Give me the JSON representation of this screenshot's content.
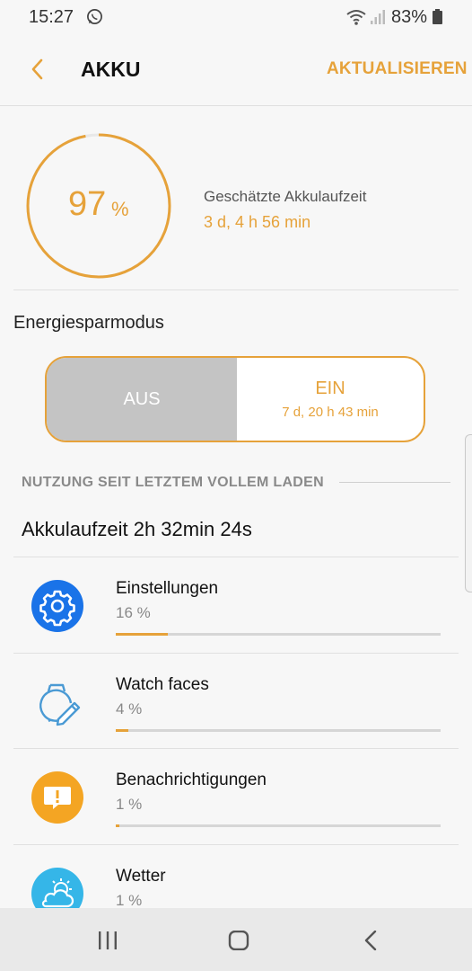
{
  "status_bar": {
    "time": "15:27",
    "battery_percent": "83%",
    "icons": [
      "whatsapp-icon",
      "wifi-icon",
      "signal-icon",
      "battery-icon"
    ]
  },
  "header": {
    "title": "AKKU",
    "action": "AKTUALISIEREN"
  },
  "battery": {
    "percent": "97",
    "percent_unit": "%",
    "level": 0.97,
    "estimate_label": "Geschätzte Akkulaufzeit",
    "estimate_value": "3 d, 4 h 56 min"
  },
  "power_saving": {
    "label": "Energiesparmodus",
    "off_label": "AUS",
    "on_label": "EIN",
    "on_sub": "7 d, 20 h 43 min",
    "selected": "AUS"
  },
  "usage": {
    "heading": "NUTZUNG SEIT LETZTEM VOLLEM LADEN",
    "runtime": "Akkulaufzeit 2h 32min 24s",
    "apps": [
      {
        "name": "Einstellungen",
        "percent": "16 %",
        "share": 0.16,
        "icon": "gear-icon"
      },
      {
        "name": "Watch faces",
        "percent": "4 %",
        "share": 0.04,
        "icon": "watch-face-icon"
      },
      {
        "name": "Benachrichtigungen",
        "percent": "1 %",
        "share": 0.01,
        "icon": "notification-icon"
      },
      {
        "name": "Wetter",
        "percent": "1 %",
        "share": 0.01,
        "icon": "weather-icon"
      }
    ]
  },
  "colors": {
    "accent": "#e6a23a",
    "settings_blue": "#1a73e8",
    "watch_blue": "#4a9ad4",
    "notification_orange": "#f4a523",
    "weather_blue": "#35b6e8"
  },
  "navigation": {
    "recent": "recent-apps-icon",
    "home": "home-icon",
    "back": "back-icon"
  }
}
